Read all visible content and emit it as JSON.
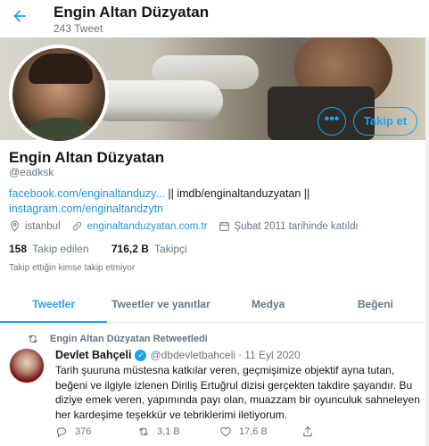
{
  "topbar": {
    "name": "Engin Altan Düzyatan",
    "tweet_count": "243 Tweet"
  },
  "profile": {
    "name": "Engin Altan Düzyatan",
    "handle": "@eadksk",
    "bio": {
      "link1": "facebook.com/enginaltanduzy...",
      "sep1": " || imdb/enginaltanduzyatan || ",
      "link2": "instagram.com/enginaltandzytn"
    },
    "location": "istanbul",
    "website": "enginaltanduzyatan.com.tr",
    "joined": "Şubat 2011 tarihinde katıldı",
    "following_count": "158",
    "following_label": "Takip edilen",
    "followers_count": "716,2 B",
    "followers_label": "Takipçi",
    "no_followers_you_know": "Takip ettiğin kimse takip etmiyor"
  },
  "buttons": {
    "more": "•••",
    "follow": "Takip et"
  },
  "tabs": [
    {
      "label": "Tweetler",
      "active": true
    },
    {
      "label": "Tweetler ve yanıtlar",
      "active": false
    },
    {
      "label": "Medya",
      "active": false
    },
    {
      "label": "Beğeni",
      "active": false
    }
  ],
  "tweet": {
    "retweeted_by": "Engin Altan Düzyatan Retweetledi",
    "author_name": "Devlet Bahçeli",
    "author_handle": "@dbdevletbahceli",
    "date": "11 Eyl 2020",
    "text": "Tarih şuuruna müstesna katkılar veren, geçmişimize objektif ayna tutan, beğeni ve ilgiyle izlenen Diriliş Ertuğrul dizisi gerçekten takdire şayandır. Bu diziye emek veren, yapımında payı olan, muazzam bir oyunculuk sahneleyen her kardeşime teşekkür ve tebriklerimi iletiyorum.",
    "replies": "376",
    "retweets": "3,1 B",
    "likes": "17,6 B"
  },
  "colors": {
    "accent": "#1da1f2",
    "link": "#1b95e0",
    "muted": "#657786",
    "text": "#14171a"
  }
}
